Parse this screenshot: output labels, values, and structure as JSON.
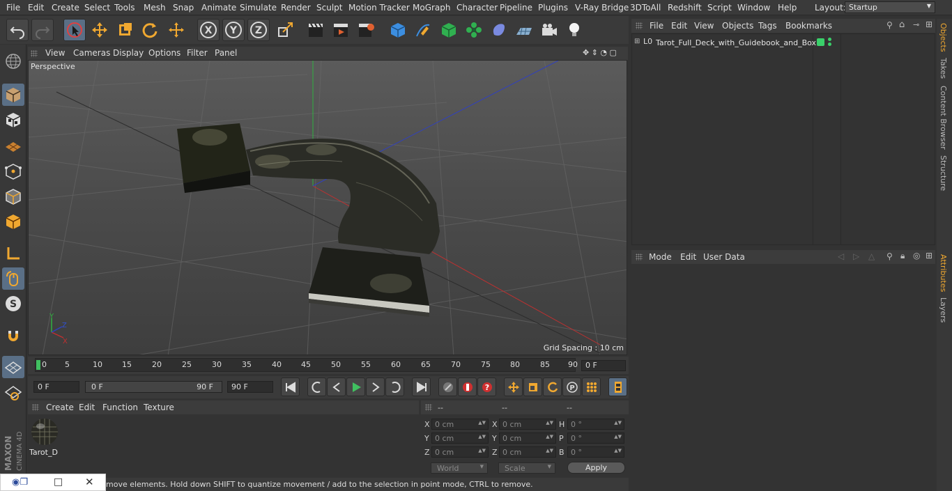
{
  "menu": [
    "File",
    "Edit",
    "Create",
    "Select",
    "Tools",
    "Mesh",
    "Snap",
    "Animate",
    "Simulate",
    "Render",
    "Sculpt",
    "Motion Tracker",
    "MoGraph",
    "Character",
    "Pipeline",
    "Plugins",
    "V-Ray Bridge",
    "3DToAll",
    "Redshift",
    "Script",
    "Window",
    "Help"
  ],
  "layout": {
    "label": "Layout:",
    "value": "Startup"
  },
  "viewport": {
    "menu": [
      "View",
      "Cameras",
      "Display",
      "Options",
      "Filter",
      "Panel"
    ],
    "label": "Perspective",
    "grid_spacing": "Grid Spacing : 10 cm",
    "axis": {
      "x": "X",
      "y": "Y",
      "z": "Z"
    }
  },
  "timeline": {
    "ticks": [
      "0",
      "5",
      "10",
      "15",
      "20",
      "25",
      "30",
      "35",
      "40",
      "45",
      "50",
      "55",
      "60",
      "65",
      "70",
      "75",
      "80",
      "85",
      "90"
    ],
    "current_frame": "0 F"
  },
  "transport": {
    "start": "0 F",
    "range_start": "0 F",
    "range_end": "90 F",
    "end": "90 F"
  },
  "materials": {
    "menu": [
      "Create",
      "Edit",
      "Function",
      "Texture"
    ],
    "items": [
      {
        "name": "Tarot_D"
      }
    ]
  },
  "coordinates": {
    "header": [
      "--",
      "--",
      "--"
    ],
    "rows": [
      {
        "pos_label": "X",
        "pos": "0 cm",
        "size_label": "X",
        "size": "0 cm",
        "rot_label": "H",
        "rot": "0 °"
      },
      {
        "pos_label": "Y",
        "pos": "0 cm",
        "size_label": "Y",
        "size": "0 cm",
        "rot_label": "P",
        "rot": "0 °"
      },
      {
        "pos_label": "Z",
        "pos": "0 cm",
        "size_label": "Z",
        "size": "0 cm",
        "rot_label": "B",
        "rot": "0 °"
      }
    ],
    "mode": "World",
    "scale": "Scale",
    "apply": "Apply"
  },
  "status": "move elements. Hold down SHIFT to quantize movement / add to the selection in point mode, CTRL to remove.",
  "object_manager": {
    "menu": [
      "File",
      "Edit",
      "View",
      "Objects",
      "Tags",
      "Bookmarks"
    ],
    "objects": [
      {
        "name": "Tarot_Full_Deck_with_Guidebook_and_Box",
        "layer": "L0"
      }
    ]
  },
  "attributes": {
    "menu": [
      "Mode",
      "Edit",
      "User Data"
    ]
  },
  "right_tabs": [
    "Objects",
    "Takes",
    "Content Browser",
    "Structure",
    "Attributes",
    "Layers"
  ],
  "brand": {
    "maxon": "MAXON",
    "product": "CINEMA 4D"
  },
  "colors": {
    "accent": "#f0a830",
    "active_tool": "#5a6f86",
    "green_tag": "#3ad06a"
  }
}
